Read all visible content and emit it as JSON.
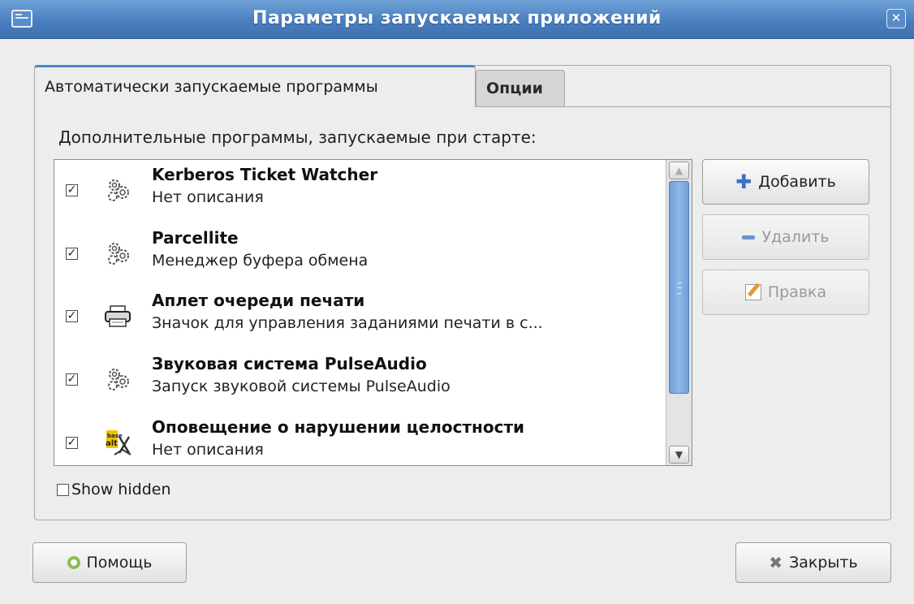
{
  "window": {
    "title": "Параметры запускаемых приложений",
    "close_symbol": "✕"
  },
  "tabs": [
    {
      "label": "Автоматически запускаемые программы",
      "active": true
    },
    {
      "label": "Опции",
      "active": false
    }
  ],
  "section_label": "Дополнительные программы, запускаемые при старте:",
  "programs": [
    {
      "name": "Kerberos Ticket Watcher",
      "description": "Нет описания",
      "checked": true,
      "icon": "gears-icon"
    },
    {
      "name": "Parcellite",
      "description": "Менеджер буфера обмена",
      "checked": true,
      "icon": "gears-icon"
    },
    {
      "name": "Аплет очереди печати",
      "description": "Значок для управления заданиями печати в с...",
      "checked": true,
      "icon": "printer-icon"
    },
    {
      "name": "Звуковая система PulseAudio",
      "description": "Запуск звуковой системы PulseAudio",
      "checked": true,
      "icon": "gears-icon"
    },
    {
      "name": "Оповещение о нарушении целостности",
      "description": "Нет описания",
      "checked": true,
      "icon": "altlinux-icon"
    }
  ],
  "buttons": {
    "add": "Добавить",
    "remove": "Удалить",
    "edit": "Правка",
    "help": "Помощь",
    "close": "Закрыть"
  },
  "show_hidden": {
    "label": "Show hidden",
    "checked": false
  },
  "colors": {
    "titlebar": "#4a7fbf",
    "scroll_thumb": "#7aa8de",
    "tab_accent": "#4b86c8"
  }
}
